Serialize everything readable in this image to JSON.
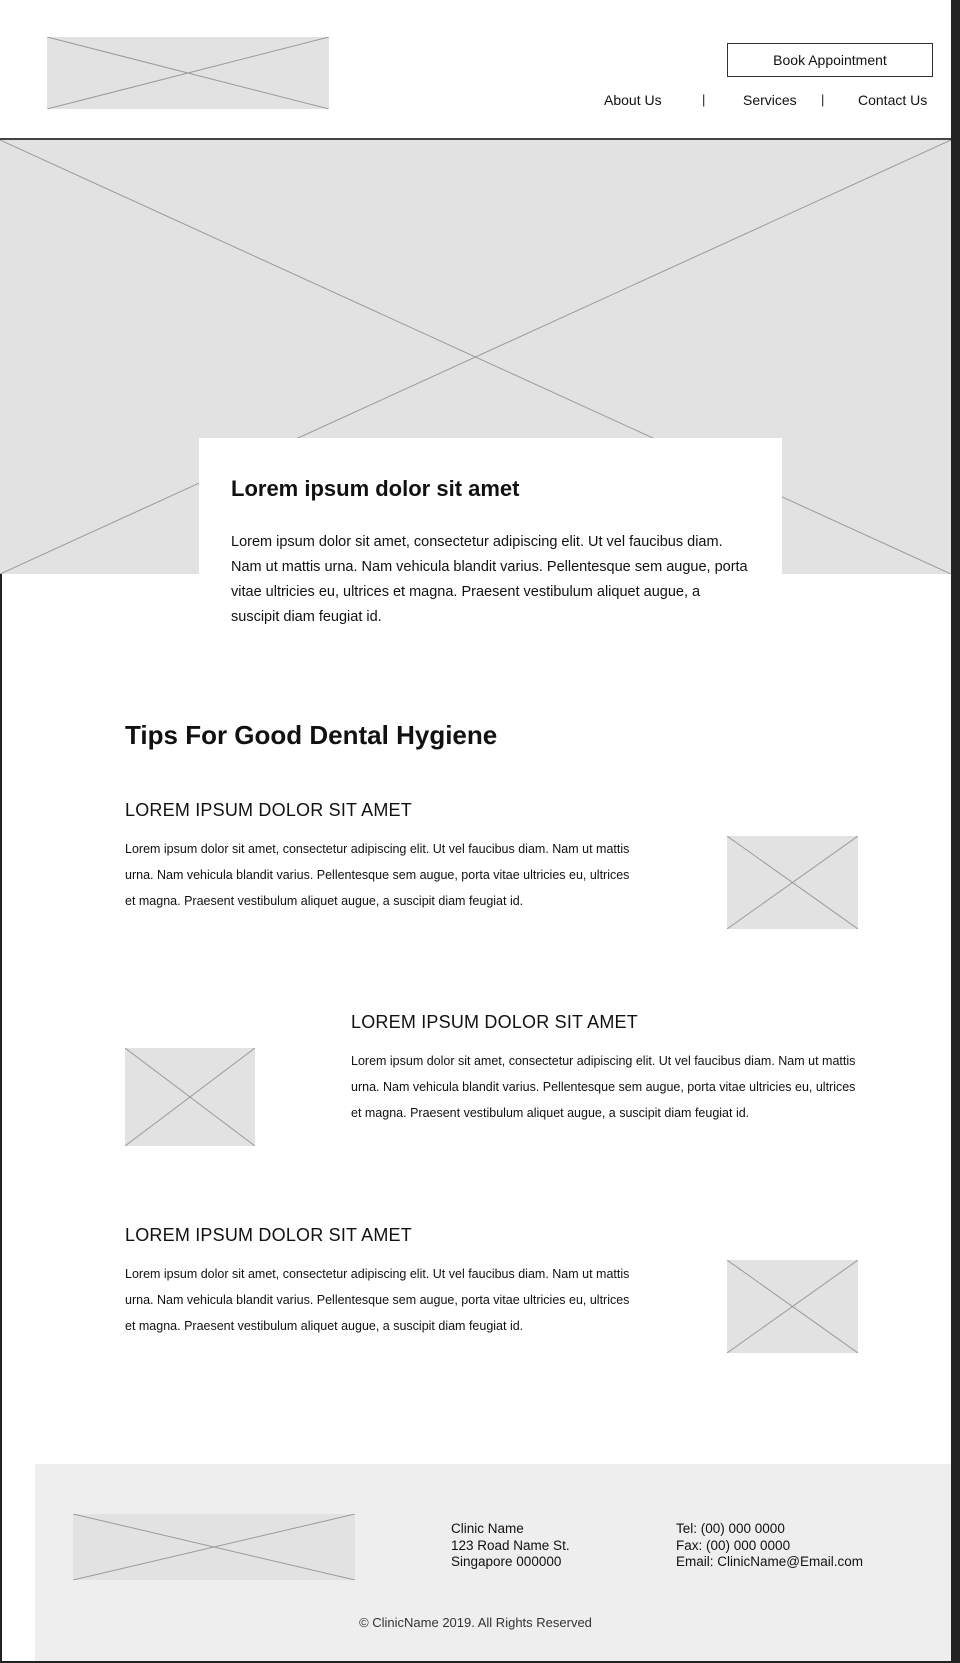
{
  "header": {
    "book_button": "Book Appointment",
    "nav": [
      "About Us",
      "Services",
      "Contact Us"
    ],
    "separator": "|"
  },
  "hero": {
    "title": "Lorem ipsum dolor sit amet",
    "text": "Lorem ipsum dolor sit amet, consectetur adipiscing elit. Ut vel faucibus diam. Nam ut mattis urna. Nam vehicula blandit varius. Pellentesque sem augue, porta vitae ultricies eu, ultrices et magna. Praesent vestibulum aliquet augue, a suscipit diam feugiat id."
  },
  "tips": {
    "title": "Tips For Good Dental Hygiene",
    "items": [
      {
        "heading": "LOREM IPSUM DOLOR SIT AMET",
        "text": "Lorem ipsum dolor sit amet, consectetur adipiscing elit. Ut vel faucibus diam. Nam ut mattis urna. Nam vehicula blandit varius. Pellentesque sem augue, porta vitae ultricies eu, ultrices et magna. Praesent vestibulum aliquet augue, a suscipit diam feugiat id."
      },
      {
        "heading": "LOREM IPSUM DOLOR SIT AMET",
        "text": "Lorem ipsum dolor sit amet, consectetur adipiscing elit. Ut vel faucibus diam. Nam ut mattis urna. Nam vehicula blandit varius. Pellentesque sem augue, porta vitae ultricies eu, ultrices et magna. Praesent vestibulum aliquet augue, a suscipit diam feugiat id."
      },
      {
        "heading": "LOREM IPSUM DOLOR SIT AMET",
        "text": "Lorem ipsum dolor sit amet, consectetur adipiscing elit. Ut vel faucibus diam. Nam ut mattis urna. Nam vehicula blandit varius. Pellentesque sem augue, porta vitae ultricies eu, ultrices et magna. Praesent vestibulum aliquet augue, a suscipit diam feugiat id."
      }
    ]
  },
  "footer": {
    "address": [
      "Clinic Name",
      "123 Road Name St.",
      "Singapore 000000"
    ],
    "contact": [
      "Tel: (00) 000 0000",
      "Fax: (00) 000 0000",
      "Email: ClinicName@Email.com"
    ],
    "copyright": "© ClinicName 2019. All Rights Reserved"
  },
  "colors": {
    "placeholder": "#e2e2e2",
    "footer_bg": "#eeeeee",
    "border": "#222222"
  }
}
